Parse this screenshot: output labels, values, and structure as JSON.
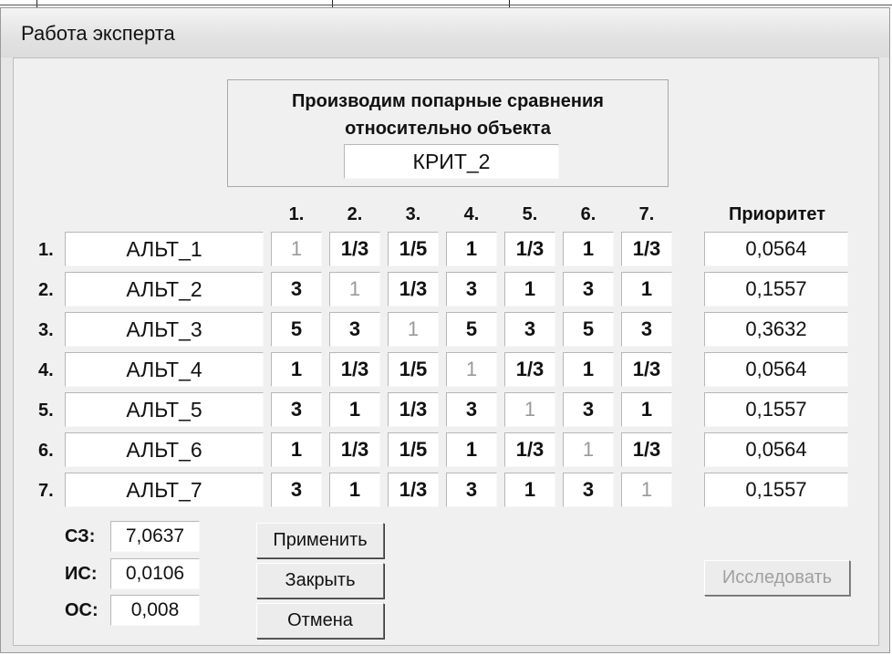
{
  "window": {
    "title": "Работа эксперта"
  },
  "header": {
    "line1": "Производим попарные сравнения",
    "line2": "относительно объекта",
    "object": "КРИТ_2"
  },
  "columns": [
    "1.",
    "2.",
    "3.",
    "4.",
    "5.",
    "6.",
    "7."
  ],
  "priority_header": "Приоритет",
  "rows": [
    {
      "num": "1.",
      "name": "АЛЬТ_1",
      "values": [
        "1",
        "1/3",
        "1/5",
        "1",
        "1/3",
        "1",
        "1/3"
      ],
      "priority": "0,0564"
    },
    {
      "num": "2.",
      "name": "АЛЬТ_2",
      "values": [
        "3",
        "1",
        "1/3",
        "3",
        "1",
        "3",
        "1"
      ],
      "priority": "0,1557"
    },
    {
      "num": "3.",
      "name": "АЛЬТ_3",
      "values": [
        "5",
        "3",
        "1",
        "5",
        "3",
        "5",
        "3"
      ],
      "priority": "0,3632"
    },
    {
      "num": "4.",
      "name": "АЛЬТ_4",
      "values": [
        "1",
        "1/3",
        "1/5",
        "1",
        "1/3",
        "1",
        "1/3"
      ],
      "priority": "0,0564"
    },
    {
      "num": "5.",
      "name": "АЛЬТ_5",
      "values": [
        "3",
        "1",
        "1/3",
        "3",
        "1",
        "3",
        "1"
      ],
      "priority": "0,1557"
    },
    {
      "num": "6.",
      "name": "АЛЬТ_6",
      "values": [
        "1",
        "1/3",
        "1/5",
        "1",
        "1/3",
        "1",
        "1/3"
      ],
      "priority": "0,0564"
    },
    {
      "num": "7.",
      "name": "АЛЬТ_7",
      "values": [
        "3",
        "1",
        "1/3",
        "3",
        "1",
        "3",
        "1"
      ],
      "priority": "0,1557"
    }
  ],
  "stats": [
    {
      "label": "СЗ:",
      "value": "7,0637"
    },
    {
      "label": "ИС:",
      "value": "0,0106"
    },
    {
      "label": "ОС:",
      "value": "0,008"
    }
  ],
  "buttons": {
    "apply": "Применить",
    "close": "Закрыть",
    "cancel": "Отмена",
    "research": "Исследовать"
  }
}
